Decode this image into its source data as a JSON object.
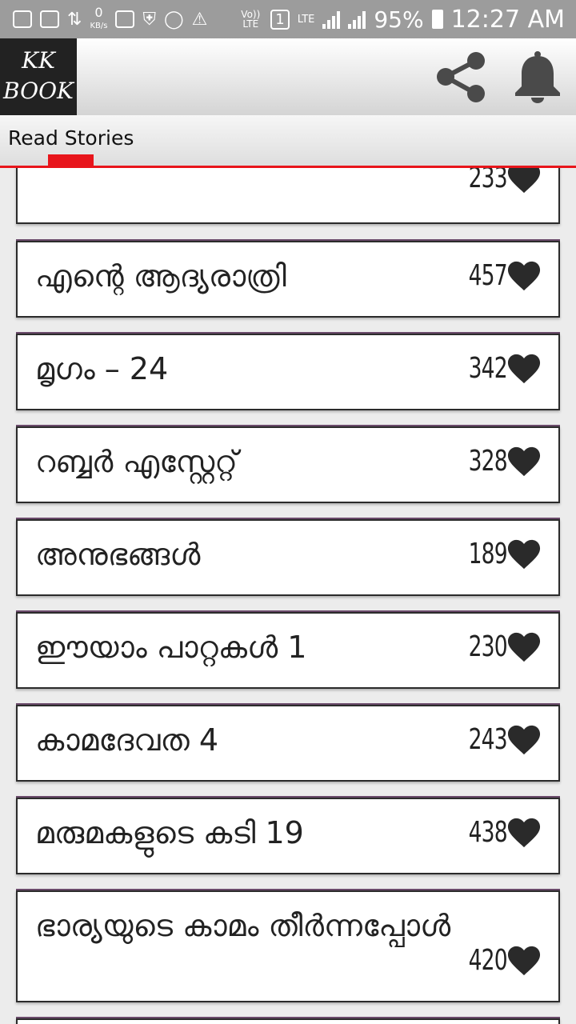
{
  "status_bar": {
    "speed": "0",
    "speed_unit": "KB/s",
    "volte": "Vo)) LTE",
    "sim": "1",
    "network": "LTE",
    "battery": "95%",
    "time": "12:27 AM"
  },
  "app": {
    "logo_line1": "KK",
    "logo_line2": "BOOK",
    "share_icon": "share-icon",
    "bell_icon": "bell-icon"
  },
  "tabs": [
    {
      "label": "Read Stories",
      "active": true
    }
  ],
  "colors": {
    "accent": "#e8151b",
    "icon_gray": "#4a4a4a",
    "heart": "#2a2a2a"
  },
  "stories": [
    {
      "title": "",
      "likes": "233"
    },
    {
      "title": "എന്റെ ആദ്യരാത്രി",
      "likes": "457"
    },
    {
      "title": "മൃഗം – 24",
      "likes": "342"
    },
    {
      "title": "റബ്ബർ എസ്റ്റേറ്റ്",
      "likes": "328"
    },
    {
      "title": "അനുഭങ്ങൾ",
      "likes": "189"
    },
    {
      "title": "ഈയാം പാറ്റകൾ 1",
      "likes": "230"
    },
    {
      "title": "കാമദേവത 4",
      "likes": "243"
    },
    {
      "title": "മരുമകളുടെ കടി  19",
      "likes": "438"
    },
    {
      "title": "ഭാര്യയുടെ കാമം തീർന്നപ്പോൾ",
      "likes": "420"
    }
  ]
}
